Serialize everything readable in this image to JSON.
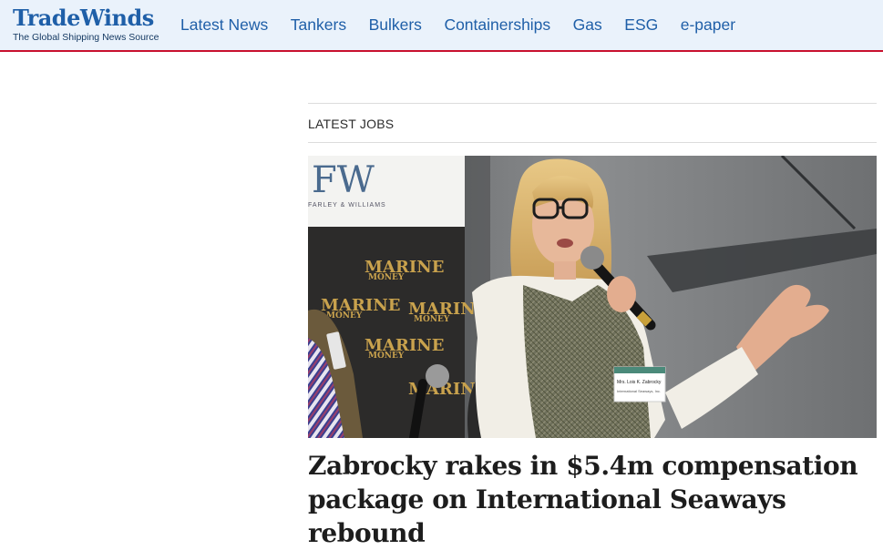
{
  "header": {
    "logo_name": "TradeWinds",
    "logo_tagline": "The Global Shipping News Source",
    "nav": [
      {
        "label": "Latest News"
      },
      {
        "label": "Tankers"
      },
      {
        "label": "Bulkers"
      },
      {
        "label": "Containerships"
      },
      {
        "label": "Gas"
      },
      {
        "label": "ESG"
      },
      {
        "label": "e-paper"
      }
    ],
    "accent_color": "#c8102e",
    "brand_color": "#1f5fa8"
  },
  "section": {
    "label": "LATEST JOBS"
  },
  "article": {
    "headline": "Zabrocky rakes in $5.4m compensation package on International Seaways rebound",
    "image": {
      "backdrop_brand": "MARINE",
      "backdrop_brand_sub": "MONEY",
      "logo_letters": "FW",
      "logo_sub": "FARLEY & WILLIAMS",
      "badge_name": "Mrs. Lois K. Zabrocky",
      "badge_org": "International Seaways, Inc."
    }
  }
}
